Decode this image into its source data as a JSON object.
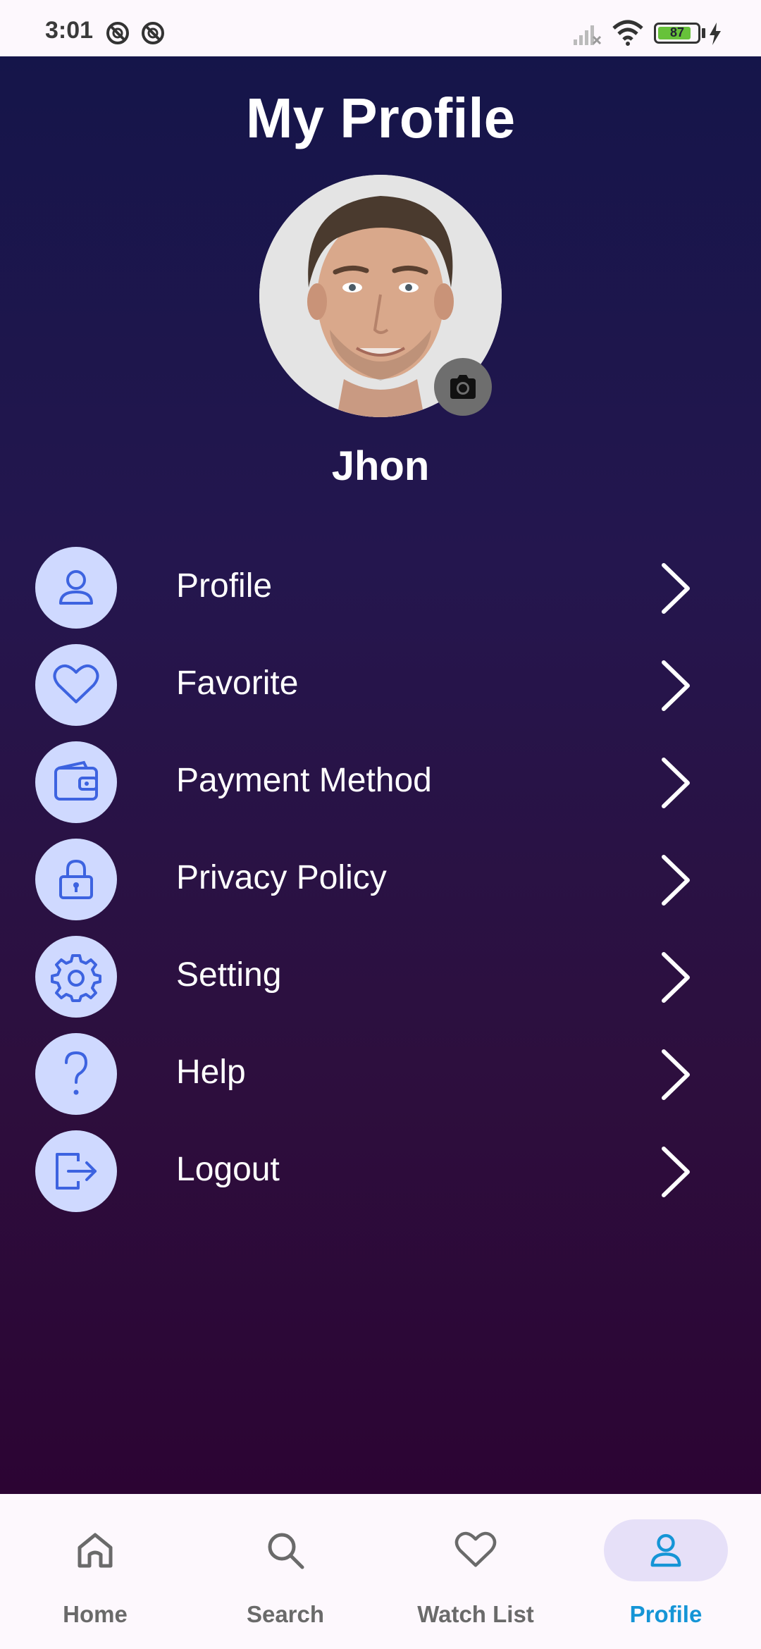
{
  "status_bar": {
    "time": "3:01",
    "battery": "87",
    "battery_level": 0.87
  },
  "header": {
    "title": "My Profile"
  },
  "profile": {
    "name": "Jhon"
  },
  "menu": {
    "items": [
      {
        "label": "Profile",
        "icon": "user-icon"
      },
      {
        "label": "Favorite",
        "icon": "heart-icon"
      },
      {
        "label": "Payment Method",
        "icon": "wallet-icon"
      },
      {
        "label": "Privacy Policy",
        "icon": "lock-icon"
      },
      {
        "label": "Setting",
        "icon": "gear-icon"
      },
      {
        "label": "Help",
        "icon": "question-icon"
      },
      {
        "label": "Logout",
        "icon": "logout-icon"
      }
    ]
  },
  "bottom_nav": {
    "items": [
      {
        "label": "Home",
        "icon": "home-icon",
        "active": false
      },
      {
        "label": "Search",
        "icon": "search-icon",
        "active": false
      },
      {
        "label": "Watch List",
        "icon": "heart-icon",
        "active": false
      },
      {
        "label": "Profile",
        "icon": "user-icon",
        "active": true
      }
    ]
  },
  "colors": {
    "gradient_top": "#15154a",
    "gradient_bottom": "#2c0433",
    "icon_circle": "#cfd9ff",
    "icon_stroke": "#3d63e0",
    "nav_active": "#1595d6",
    "nav_active_pill": "#e6e0f8"
  }
}
